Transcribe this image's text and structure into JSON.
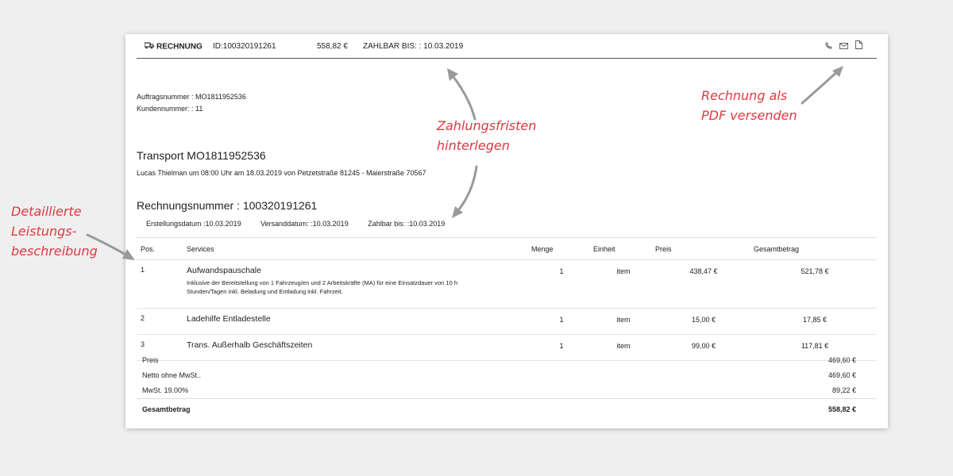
{
  "topbar": {
    "title": "RECHNUNG",
    "id": "ID:100320191261",
    "amount": "558,82 €",
    "due": "ZAHLBAR BIS: : 10.03.2019"
  },
  "meta": {
    "order": "Auftragsnummer : MO1811952536",
    "customer": "Kundennummer: : 11"
  },
  "transport": {
    "title": "Transport MO1811952536",
    "desc": "Lucas Thielman um 08:00 Uhr am 18.03.2019 von Petzetstraße 81245 - Maierstraße 70567"
  },
  "invoice": {
    "number": "Rechnungsnummer : 100320191261",
    "created": "Erstellungsdatum :10.03.2019",
    "sent": "Versanddatum: :10.03.2019",
    "payable": "Zahlbar bis: :10.03.2019"
  },
  "table": {
    "headers": [
      "Pos.",
      "Services",
      "Menge",
      "Einheit",
      "Preis",
      "Gesamtbetrag"
    ],
    "rows": [
      {
        "pos": "1",
        "service": "Aufwandspauschale",
        "desc": "Inklusive der Bereitstellung von 1 Fahrzeug/en und 2 Arbeitskräfte (MA) für eine Einsatzdauer von 10 h Stunden/Tagen inkl. Beladung und Entladung inkl. Fahrzeit.",
        "qty": "1",
        "unit": "item",
        "price": "438,47 €",
        "total": "521,78 €"
      },
      {
        "pos": "2",
        "service": "Ladehilfe Entladestelle",
        "desc": "",
        "qty": "1",
        "unit": "item",
        "price": "15,00 €",
        "total": "17,85 €"
      },
      {
        "pos": "3",
        "service": "Trans. Außerhalb Geschäftszeiten",
        "desc": "",
        "qty": "1",
        "unit": "item",
        "price": "99,00 €",
        "total": "117,81 €"
      }
    ]
  },
  "totals": {
    "price_label": "Preis",
    "price_value": "469,60 €",
    "net_label": "Netto ohne MwSt..",
    "net_value": "469,60 €",
    "vat_label": "MwSt. 19.00%",
    "vat_value": "89,22 €",
    "grand_label": "Gesamtbetrag",
    "grand_value": "558,82 €"
  },
  "annotations": {
    "left": [
      "Detaillierte",
      "Leistungs-",
      "beschreibung"
    ],
    "middle": [
      "Zahlungsfristen",
      "hinterlegen"
    ],
    "right": [
      "Rechnung als",
      "PDF versenden"
    ],
    "color": "#e0383e"
  },
  "icons": [
    "truck-icon",
    "phone-icon",
    "mail-icon",
    "document-icon"
  ]
}
